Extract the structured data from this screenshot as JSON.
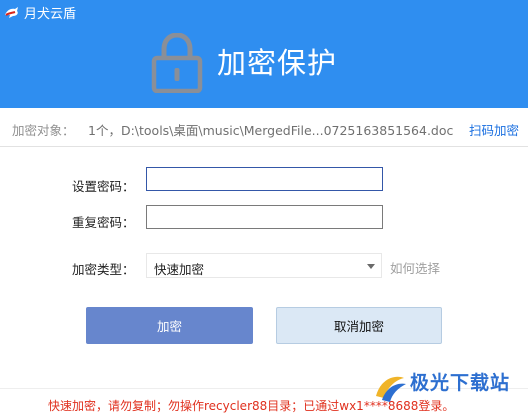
{
  "window": {
    "title": "月犬云盾"
  },
  "header": {
    "title": "加密保护",
    "icon": "lock-icon"
  },
  "target": {
    "label": "加密对象：",
    "value": "1个，D:\\tools\\桌面\\music\\MergedFile...0725163851564.doc",
    "scan_link": "扫码加密"
  },
  "form": {
    "set_password_label": "设置密码：",
    "set_password_value": "",
    "repeat_password_label": "重复密码：",
    "repeat_password_value": "",
    "type_label": "加密类型：",
    "type_selected": "快速加密",
    "how_to_choose": "如何选择"
  },
  "buttons": {
    "encrypt": "加密",
    "cancel": "取消加密"
  },
  "footer": {
    "notice": "快速加密，请勿复制；勿操作recycler88目录；已通过wx1****8688登录。"
  },
  "watermark": {
    "text": "极光下载站"
  },
  "colors": {
    "header_blue": "#2f8ef0",
    "encrypt_button": "#6786cd",
    "cancel_button": "#dbe8f5",
    "link_blue": "#1a6fe0",
    "footer_red": "#e0301e"
  }
}
